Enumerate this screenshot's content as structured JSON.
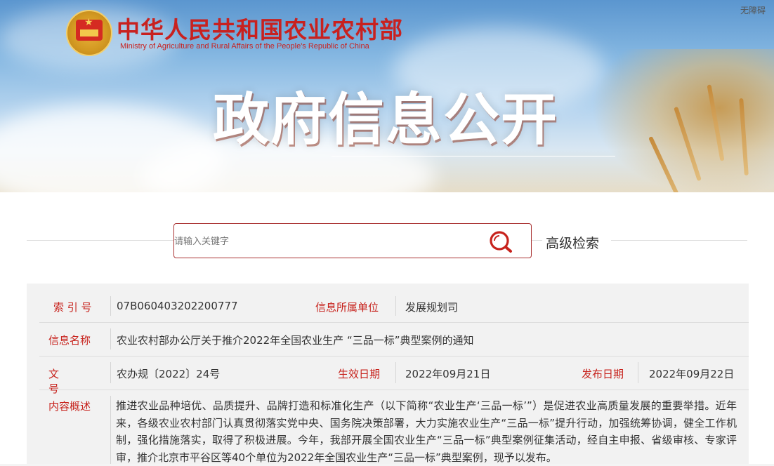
{
  "header": {
    "site_name_cn": "中华人民共和国农业农村部",
    "site_name_en": "Ministry of Agriculture and Rural Affairs of the People's Republic of China",
    "accessibility_label": "无障碍",
    "banner_title": "政府信息公开"
  },
  "search": {
    "placeholder": "请输入关键字",
    "value": "请输入关键字",
    "advanced_label": "高级检索"
  },
  "meta": {
    "index_label": "索 引 号",
    "index_value": "07B060403202200777",
    "unit_label": "信息所属单位",
    "unit_value": "发展规划司",
    "name_label": "信息名称",
    "name_value": "农业农村部办公厅关于推介2022年全国农业生产 “三品一标”典型案例的通知",
    "doc_label": "文 号",
    "doc_value": "农办规〔2022〕24号",
    "effective_label": "生效日期",
    "effective_value": "2022年09月21日",
    "publish_label": "发布日期",
    "publish_value": "2022年09月22日",
    "summary_label": "内容概述",
    "summary_value": "推进农业品种培优、品质提升、品牌打造和标准化生产（以下简称“农业生产‘三品一标’”）是促进农业高质量发展的重要举措。近年来，各级农业农村部门认真贯彻落实党中央、国务院决策部署，大力实施农业生产“三品一标”提升行动，加强统筹协调，健全工作机制，强化措施落实，取得了积极进展。今年，我部开展全国农业生产“三品一标”典型案例征集活动，经自主申报、省级审核、专家评审，推介北京市平谷区等40个单位为2022年全国农业生产“三品一标”典型案例，现予以发布。"
  },
  "colors": {
    "accent_red": "#c7221c",
    "search_border": "#aa3333"
  },
  "icons": {
    "search": "search-icon",
    "emblem": "national-emblem-icon"
  }
}
